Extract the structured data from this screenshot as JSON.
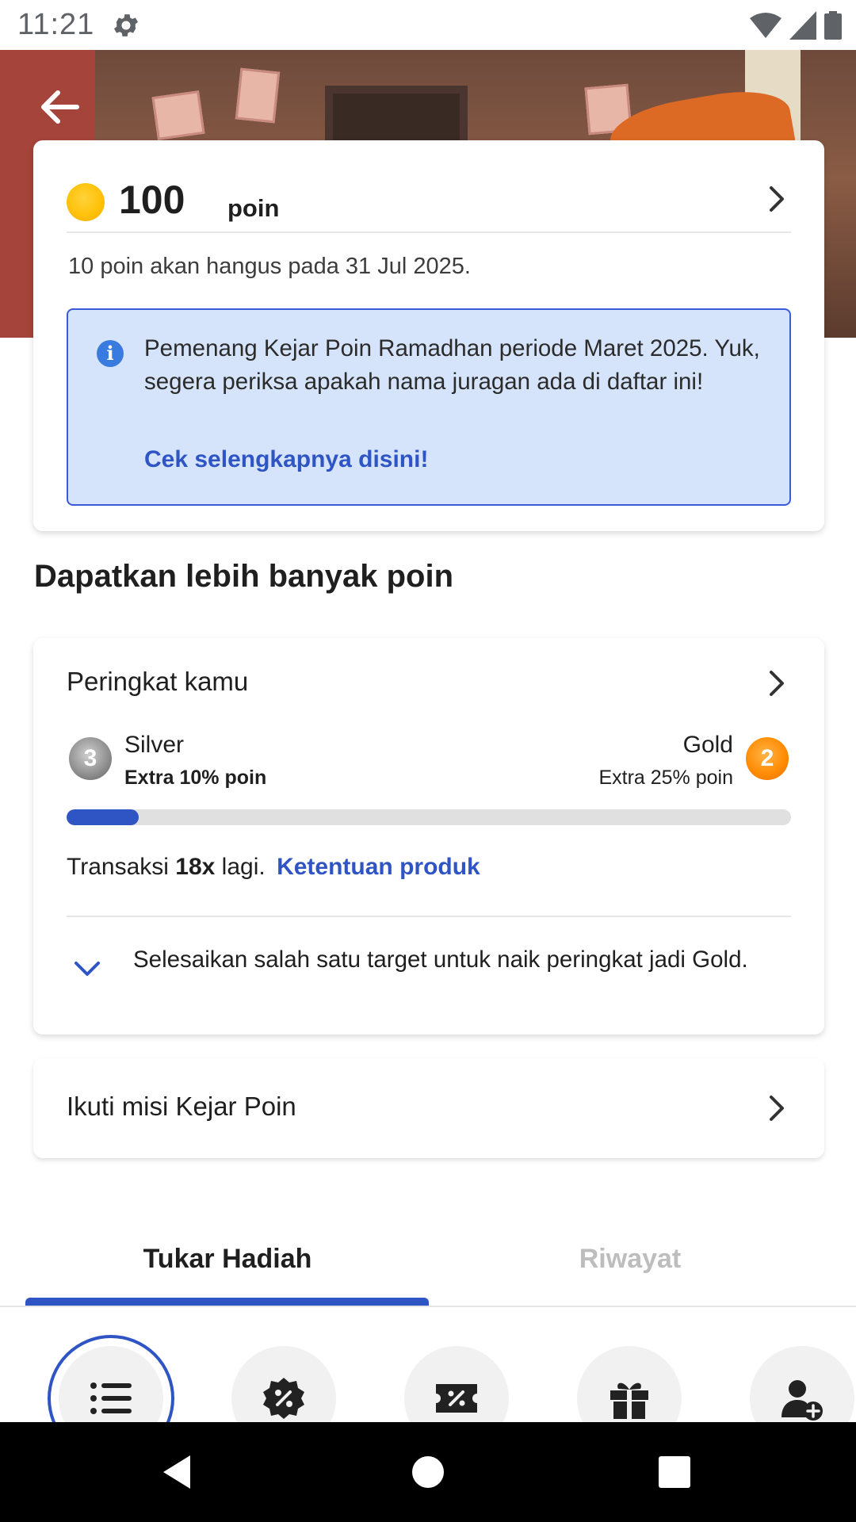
{
  "status_bar": {
    "time": "11:21",
    "icons": [
      "gear-icon",
      "wifi-icon",
      "signal-icon",
      "battery-icon"
    ]
  },
  "header": {
    "back_icon": "arrow-left-icon"
  },
  "points": {
    "value": "100",
    "unit": "poin",
    "expiry_text": "10 poin akan hangus pada 31 Jul 2025.",
    "info_text": "Pemenang Kejar Poin Ramadhan periode Maret 2025. Yuk, segera periksa apakah nama juragan ada di daftar ini!",
    "info_link": "Cek selengkapnya disini!"
  },
  "section_title": "Dapatkan lebih banyak poin",
  "rank": {
    "title": "Peringkat kamu",
    "current_tier": {
      "badge": "3",
      "name": "Silver",
      "extra": "Extra 10% poin"
    },
    "next_tier": {
      "badge": "2",
      "name": "Gold",
      "extra": "Extra 25% poin"
    },
    "progress_fraction": 0.1,
    "txn_prefix": "Transaksi",
    "txn_count": "18x",
    "txn_suffix": "lagi.",
    "terms_link": "Ketentuan produk",
    "target_text": "Selesaikan salah satu target untuk naik peringkat jadi Gold."
  },
  "mission": {
    "label": "Ikuti misi Kejar Poin"
  },
  "tabs": [
    {
      "label": "Tukar Hadiah",
      "active": true
    },
    {
      "label": "Riwayat",
      "active": false
    }
  ],
  "categories": [
    {
      "icon": "list-icon",
      "selected": true
    },
    {
      "icon": "discount-badge-icon",
      "selected": false
    },
    {
      "icon": "voucher-icon",
      "selected": false
    },
    {
      "icon": "gift-icon",
      "selected": false
    },
    {
      "icon": "add-user-icon",
      "selected": false
    }
  ],
  "colors": {
    "accent": "#2f55c5",
    "info_bg": "#d6e4fb",
    "coin": "#ffc20a",
    "gold_badge": "#ff8a00",
    "silver_badge": "#8d8d8d"
  }
}
